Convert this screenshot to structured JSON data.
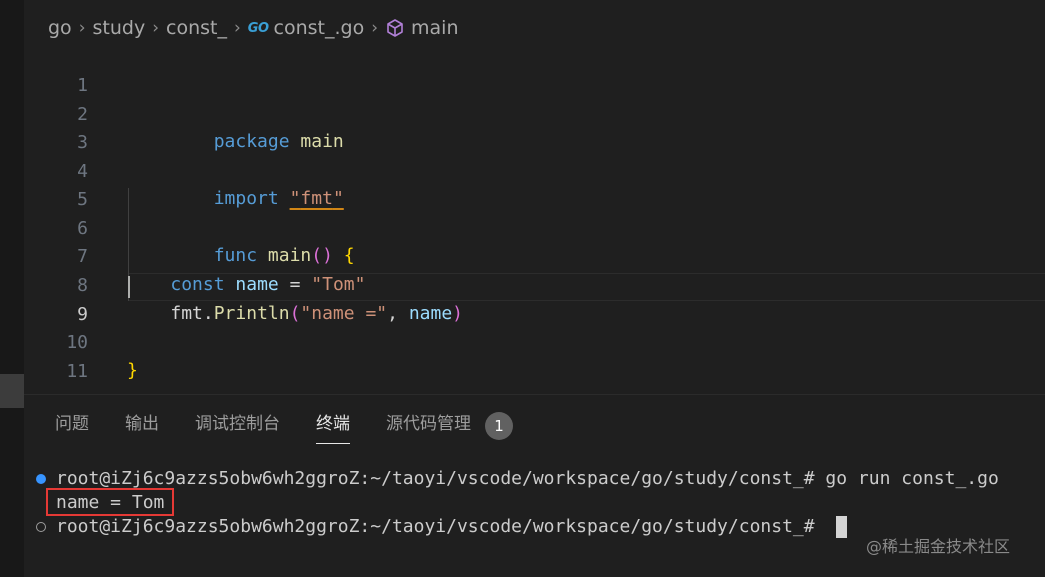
{
  "breadcrumb": {
    "items": [
      "go",
      "study",
      "const_",
      "const_.go",
      "main"
    ],
    "separator": "›",
    "go_icon_text": "GO"
  },
  "editor": {
    "line_numbers": [
      "1",
      "2",
      "3",
      "4",
      "5",
      "6",
      "7",
      "8",
      "9",
      "10",
      "11"
    ],
    "active_line": "9",
    "lines": {
      "l1": {
        "kw": "package",
        "name": "main"
      },
      "l3": {
        "kw": "import",
        "q1": "\"",
        "pkg": "fmt",
        "q2": "\""
      },
      "l5": {
        "kw": "func",
        "name": "main",
        "parens": "()",
        "brace": "{"
      },
      "l7": {
        "kw": "const",
        "name": "name",
        "eq": "=",
        "value": "\"Tom\""
      },
      "l8": {
        "pkg": "fmt",
        "dot": ".",
        "fn": "Println",
        "open": "(",
        "str": "\"name =\"",
        "comma": ",",
        "arg": "name",
        "close": ")"
      },
      "l10": {
        "brace": "}"
      }
    }
  },
  "panel": {
    "tabs": [
      "问题",
      "输出",
      "调试控制台",
      "终端",
      "源代码管理"
    ],
    "active_tab": "终端",
    "scm_badge": "1"
  },
  "terminal": {
    "line1": "root@iZj6c9azzs5obw6wh2ggroZ:~/taoyi/vscode/workspace/go/study/const_# go run const_.go",
    "line2": "name = Tom",
    "line3": "root@iZj6c9azzs5obw6wh2ggroZ:~/taoyi/vscode/workspace/go/study/const_# "
  },
  "watermark": "@稀土掘金技术社区",
  "colors": {
    "keyword": "#569cd6",
    "function": "#dcdcaa",
    "string": "#ce9178",
    "variable": "#9cdcfe",
    "highlight_box": "#e53935"
  }
}
